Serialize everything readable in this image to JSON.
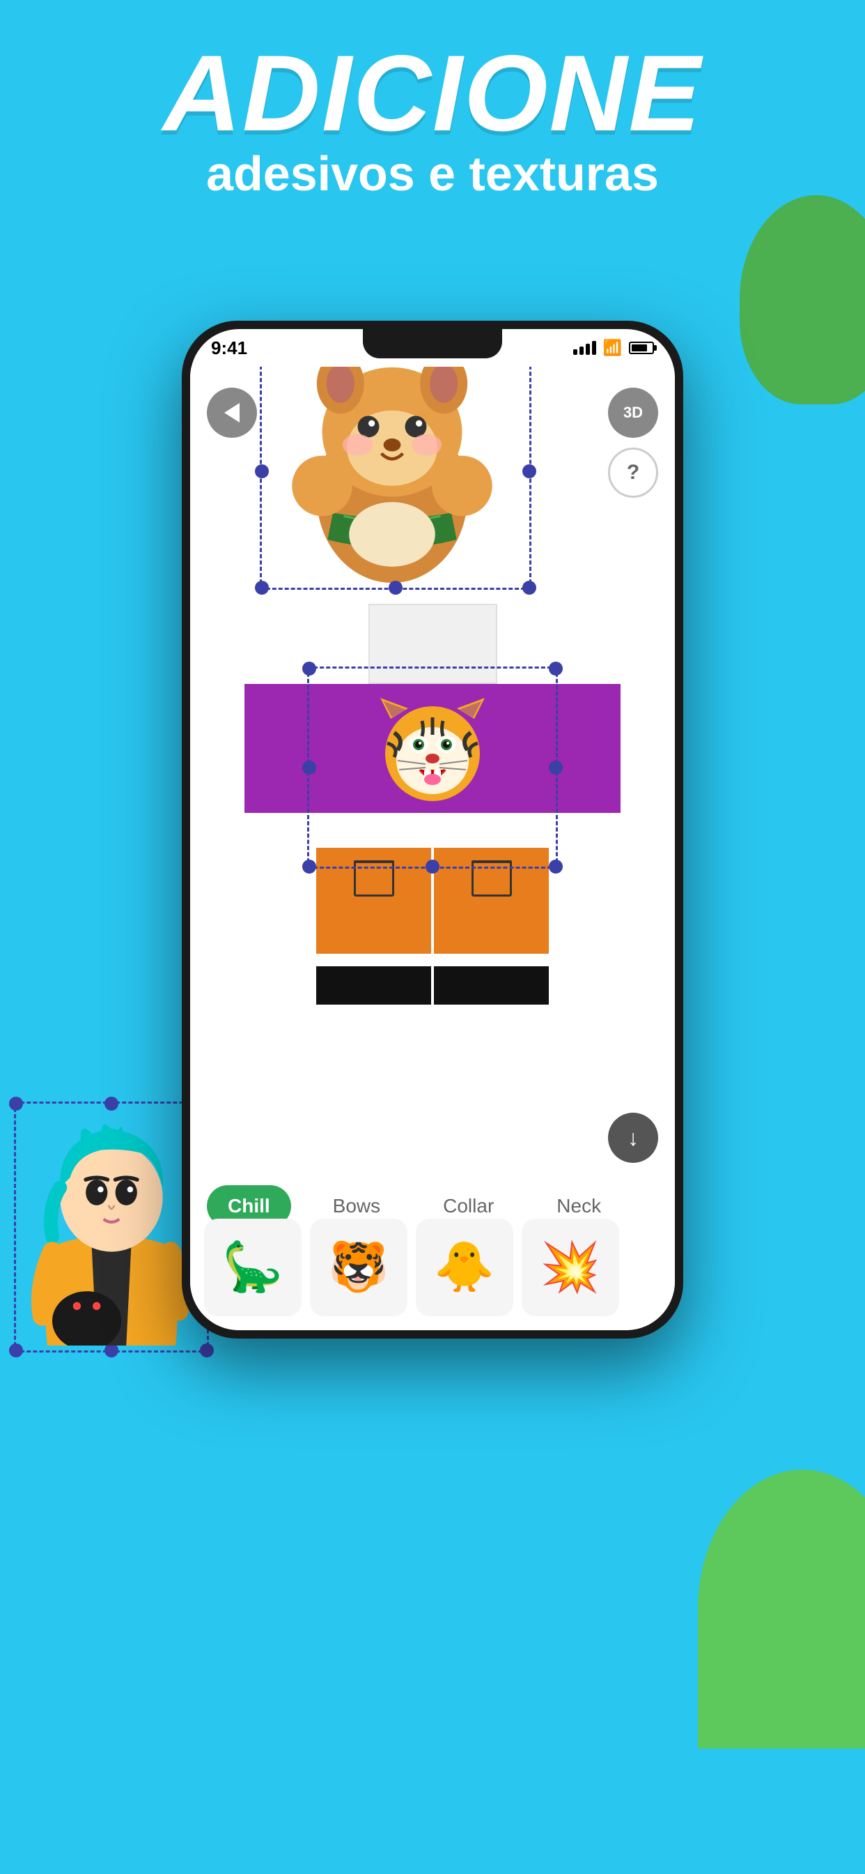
{
  "background_color": "#29C6F0",
  "header": {
    "title": "ADICIONE",
    "subtitle": "adesivos e texturas"
  },
  "phone": {
    "status_bar": {
      "time": "9:41",
      "battery_percent": 80
    },
    "back_button_label": "←",
    "button_3d_label": "3D",
    "button_help_label": "?",
    "download_button_label": "↓"
  },
  "tabs": [
    {
      "label": "Chill",
      "active": true
    },
    {
      "label": "Bows",
      "active": false
    },
    {
      "label": "Collar",
      "active": false
    },
    {
      "label": "Neck",
      "active": false
    }
  ],
  "stickers": [
    {
      "emoji": "🦕",
      "label": "dinosaur"
    },
    {
      "emoji": "🐯",
      "label": "tiger"
    },
    {
      "emoji": "🐥",
      "label": "duck"
    },
    {
      "emoji": "💥",
      "label": "explosion"
    }
  ],
  "shirt": {
    "color": "#9C27B0",
    "pants_color": "#E87D1E"
  },
  "icons": {
    "back": "←",
    "download": "↓",
    "help": "?",
    "three_d": "3D"
  }
}
